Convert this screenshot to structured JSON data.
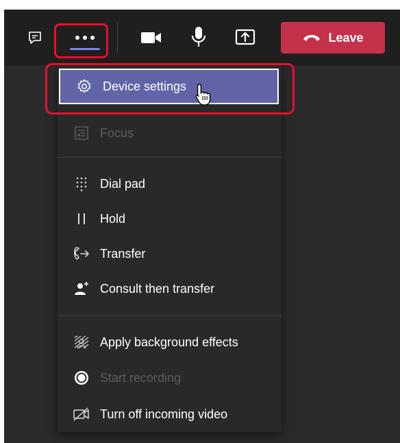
{
  "toolbar": {
    "icons": {
      "chat": "chat-icon",
      "more": "more-options-icon",
      "camera": "camera-icon",
      "mic": "microphone-icon",
      "share": "share-screen-icon",
      "leave": "phone-hangup-icon"
    },
    "leave_label": "Leave"
  },
  "menu": {
    "items": [
      {
        "label": "Device settings",
        "icon": "gear-icon",
        "state": "selected"
      },
      {
        "label": "Focus",
        "icon": "focus-icon",
        "state": "disabled"
      },
      {
        "label": "Dial pad",
        "icon": "dial-pad-icon",
        "state": "enabled"
      },
      {
        "label": "Hold",
        "icon": "hold-icon",
        "state": "enabled"
      },
      {
        "label": "Transfer",
        "icon": "transfer-icon",
        "state": "enabled"
      },
      {
        "label": "Consult then transfer",
        "icon": "consult-transfer-icon",
        "state": "enabled"
      },
      {
        "label": "Apply background effects",
        "icon": "background-effects-icon",
        "state": "enabled"
      },
      {
        "label": "Start recording",
        "icon": "record-icon",
        "state": "disabled"
      },
      {
        "label": "Turn off incoming video",
        "icon": "video-off-icon",
        "state": "enabled"
      }
    ]
  },
  "colors": {
    "toolbar_bg": "#1f1f1f",
    "menu_bg": "#292929",
    "selected_bg": "#6264a7",
    "leave_bg": "#c4314b",
    "highlight": "#e8102c",
    "disabled_text": "#5c5c5c"
  }
}
